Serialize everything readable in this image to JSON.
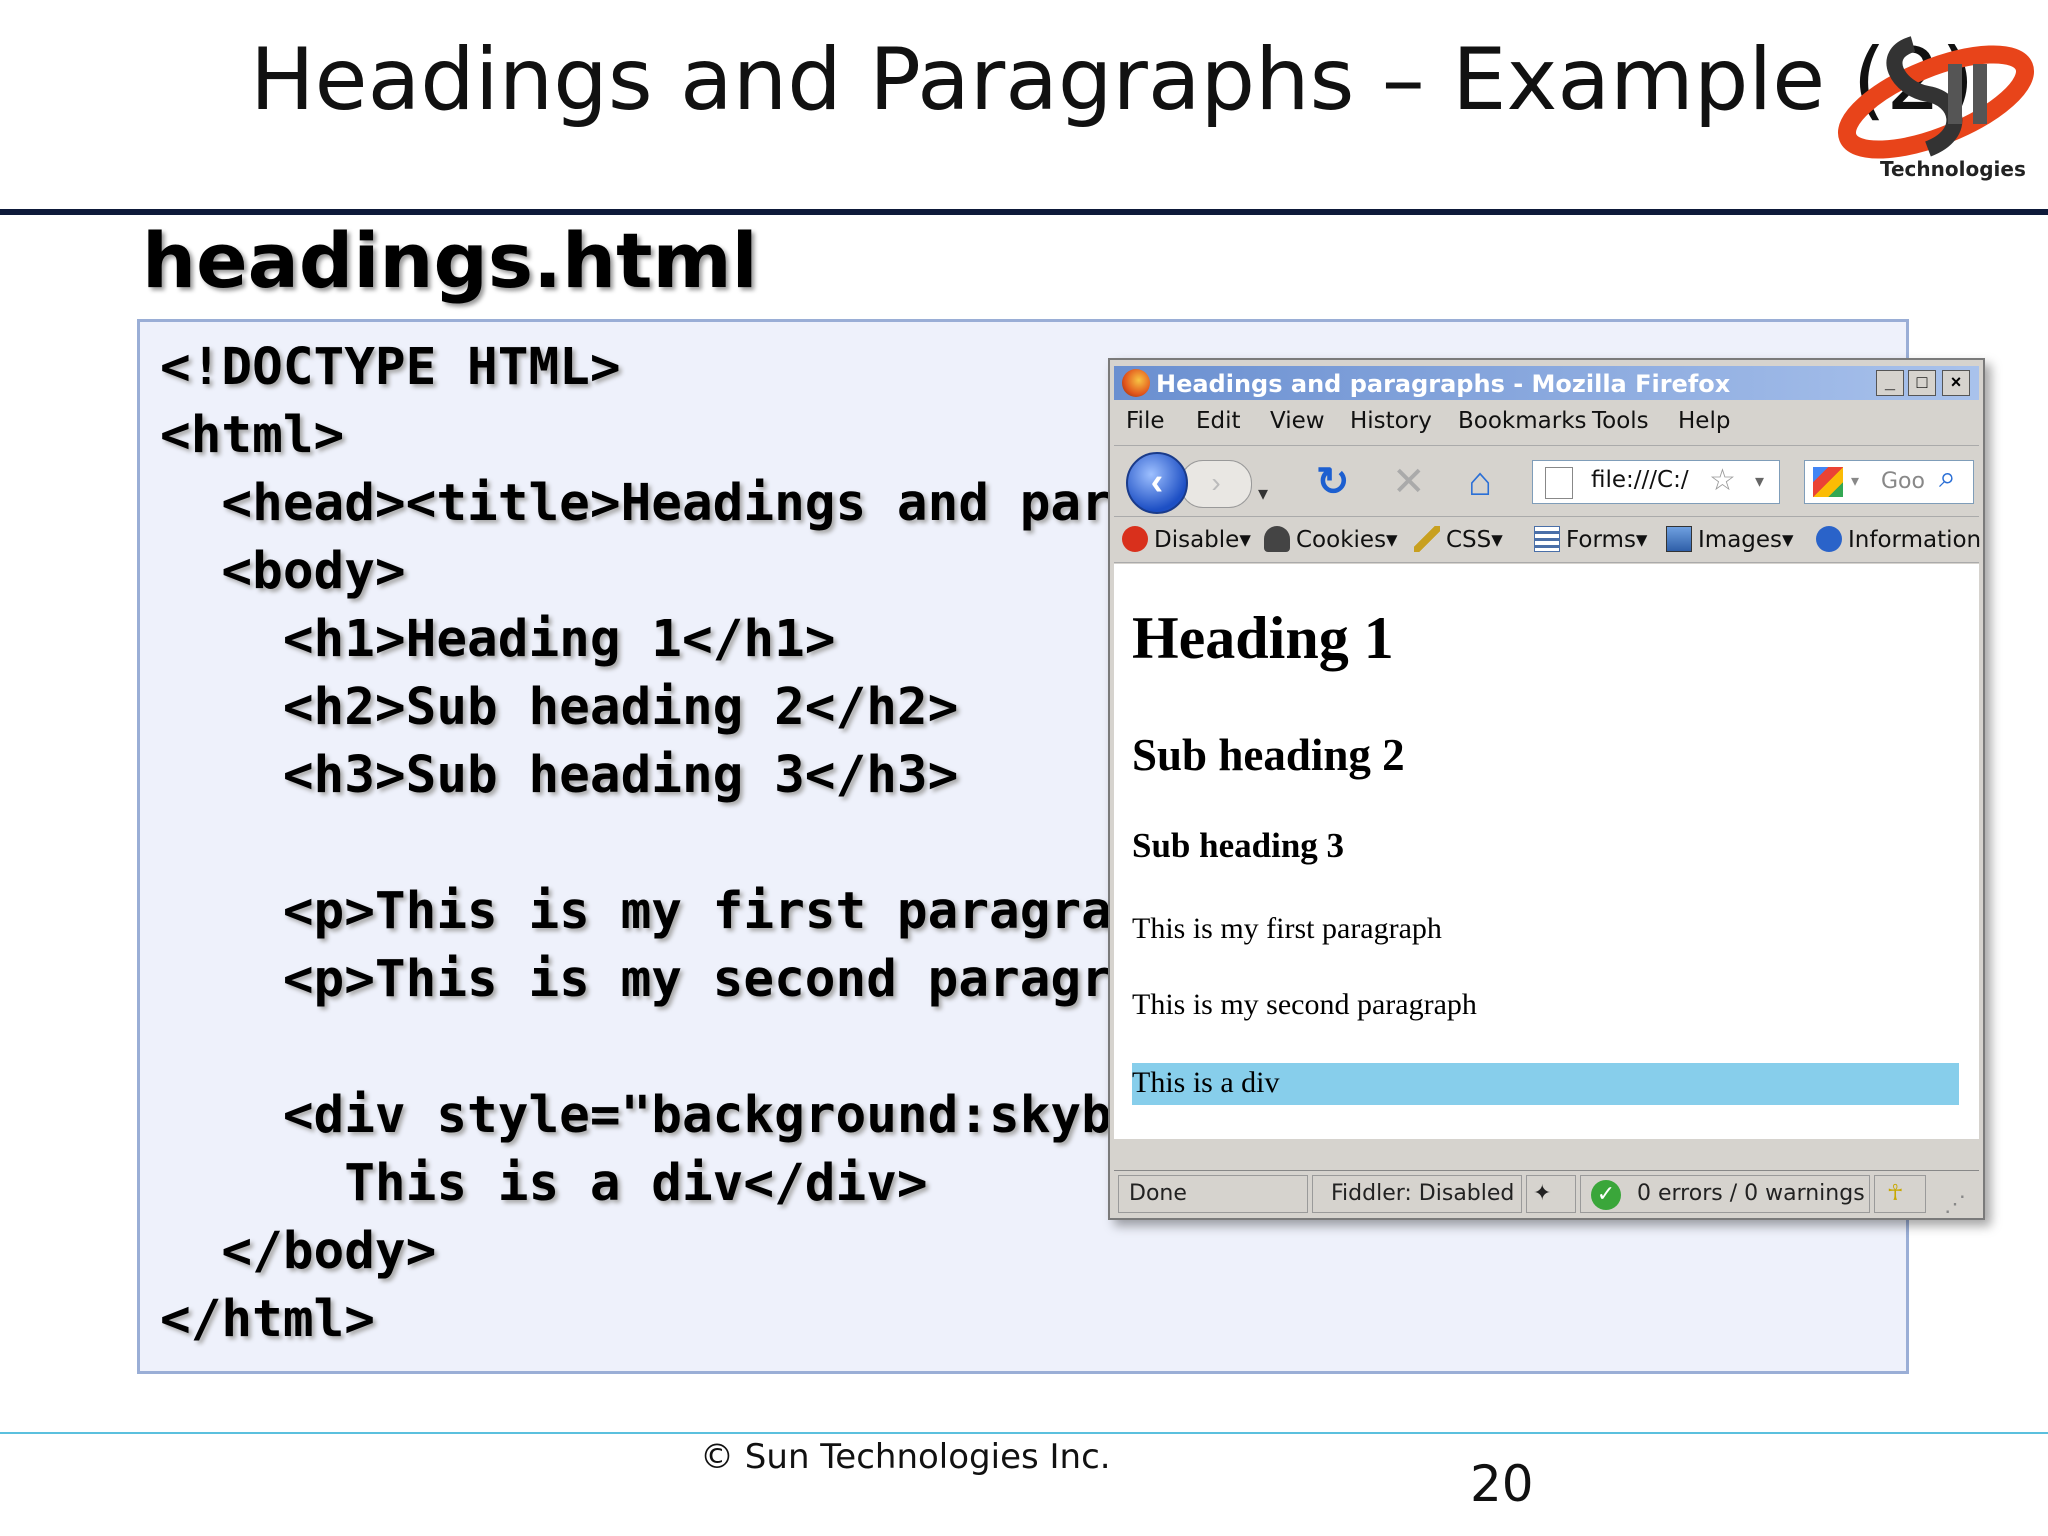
{
  "slide": {
    "title": "Headings and Paragraphs – Example (2)",
    "logo_text": "Technologies",
    "file_heading": "headings.html",
    "footer": "© Sun Technologies Inc.",
    "page_number": "20"
  },
  "code_lines": [
    "<!DOCTYPE HTML>",
    "<html>",
    "  <head><title>Headings and par",
    "  <body>",
    "    <h1>Heading 1</h1>",
    "    <h2>Sub heading 2</h2>",
    "    <h3>Sub heading 3</h3>",
    "",
    "    <p>This is my first paragra",
    "    <p>This is my second paragr",
    "",
    "    <div style=\"background:skyb",
    "      This is a div</div>",
    "  </body>",
    "</html>"
  ],
  "browser": {
    "window_title": "Headings and paragraphs - Mozilla Firefox",
    "window_buttons": {
      "minimize": "_",
      "maximize": "□",
      "close": "×"
    },
    "menu": [
      "File",
      "Edit",
      "View",
      "History",
      "Bookmarks",
      "Tools",
      "Help"
    ],
    "url": "file:///C:/",
    "search_placeholder": "Goo",
    "dev_toolbar": [
      "Disable",
      "Cookies",
      "CSS",
      "Forms",
      "Images",
      "Information"
    ],
    "page": {
      "h1": "Heading 1",
      "h2": "Sub heading 2",
      "h3": "Sub heading 3",
      "p1": "This is my first paragraph",
      "p2": "This is my second paragraph",
      "div_text": "This is a div"
    },
    "status": {
      "done": "Done",
      "fiddler": "Fiddler: Disabled",
      "errors": "0 errors / 0 warnings"
    }
  },
  "colors": {
    "title_rule": "#0e1a3a",
    "code_bg": "#eef1fb",
    "code_border": "#9aaed6",
    "div_bg": "#87ceeb",
    "footer_rule": "#5bc0de"
  }
}
